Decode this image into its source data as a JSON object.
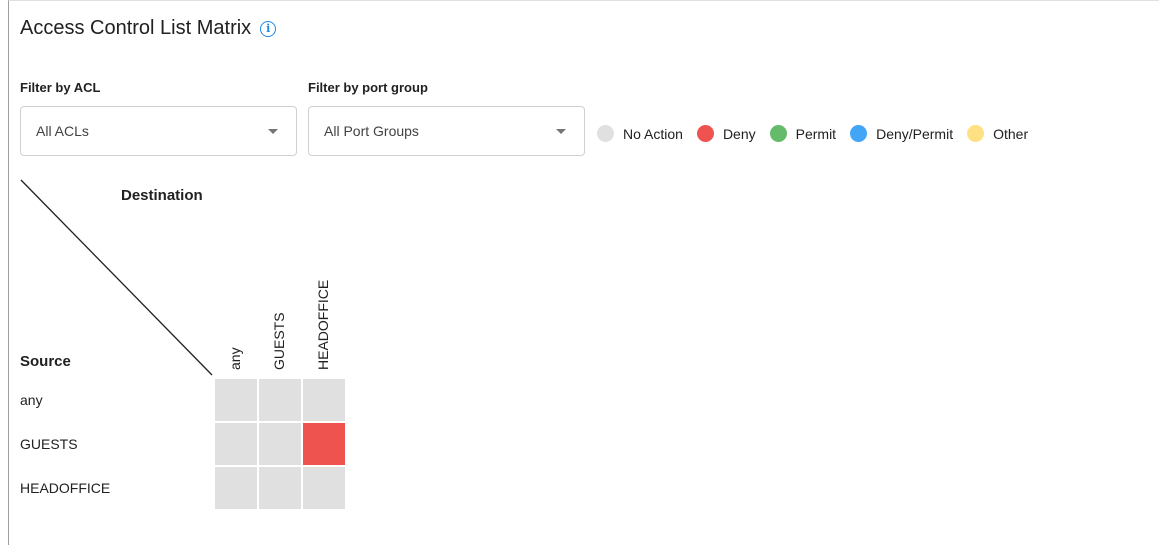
{
  "title": "Access Control List Matrix",
  "filters": {
    "acl": {
      "label": "Filter by ACL",
      "value": "All ACLs"
    },
    "port_group": {
      "label": "Filter by port group",
      "value": "All Port Groups"
    }
  },
  "legend": [
    {
      "label": "No Action",
      "color": "#e0e0e0"
    },
    {
      "label": "Deny",
      "color": "#ef5350"
    },
    {
      "label": "Permit",
      "color": "#66bb6a"
    },
    {
      "label": "Deny/Permit",
      "color": "#42a5f5"
    },
    {
      "label": "Other",
      "color": "#ffe082"
    }
  ],
  "matrix": {
    "destination_label": "Destination",
    "source_label": "Source",
    "columns": [
      "any",
      "GUESTS",
      "HEADOFFICE"
    ],
    "rows": [
      "any",
      "GUESTS",
      "HEADOFFICE"
    ],
    "cells": [
      [
        "No Action",
        "No Action",
        "No Action"
      ],
      [
        "No Action",
        "No Action",
        "Deny"
      ],
      [
        "No Action",
        "No Action",
        "No Action"
      ]
    ]
  }
}
